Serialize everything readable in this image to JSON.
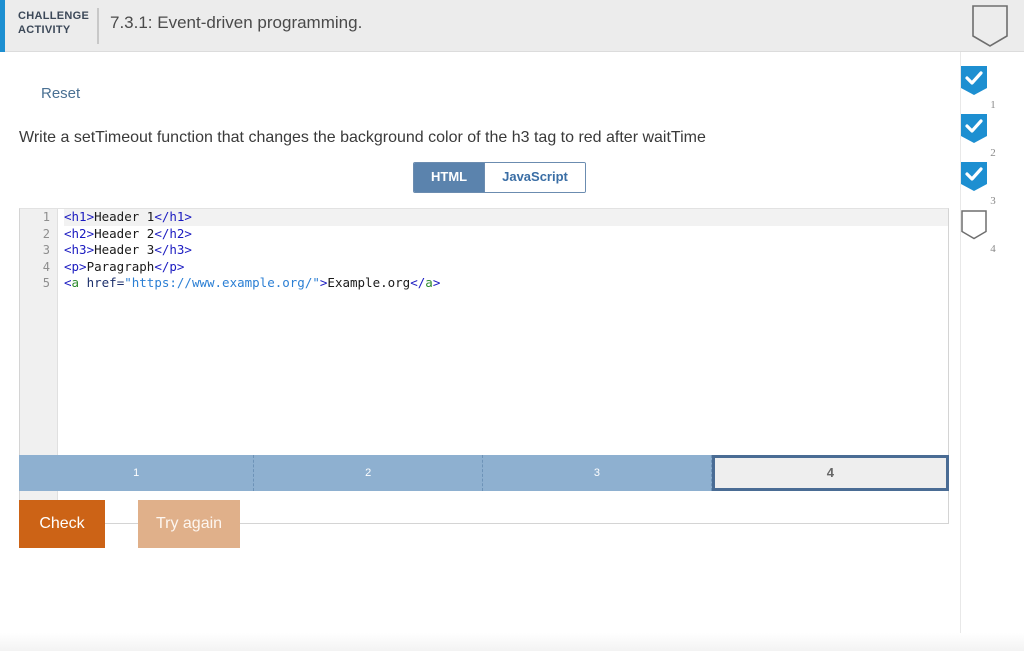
{
  "header": {
    "kicker_line1": "CHALLENGE",
    "kicker_line2": "ACTIVITY",
    "title": "7.3.1: Event-driven programming.",
    "accent_color": "#1d8fd1",
    "badge_icon": "bookmark-outline-icon"
  },
  "rail": {
    "items": [
      {
        "label": "1",
        "state": "checked",
        "icon": "bookmark-check-icon"
      },
      {
        "label": "2",
        "state": "checked",
        "icon": "bookmark-check-icon"
      },
      {
        "label": "3",
        "state": "checked",
        "icon": "bookmark-check-icon"
      },
      {
        "label": "4",
        "state": "empty",
        "icon": "bookmark-outline-icon"
      }
    ],
    "checked_color": "#1d8fd1",
    "empty_border_color": "#6e6e6e"
  },
  "main": {
    "reset_label": "Reset",
    "prompt": "Write a setTimeout function that changes the background color of the h3 tag to red after waitTime"
  },
  "tabs": {
    "items": [
      {
        "label": "HTML",
        "active": true
      },
      {
        "label": "JavaScript",
        "active": false
      }
    ],
    "active_bg": "#5b83ad",
    "inactive_fg": "#3a6ea5"
  },
  "editor": {
    "language": "HTML",
    "line_numbers": [
      "1",
      "2",
      "3",
      "4",
      "5"
    ],
    "lines": [
      {
        "number": "1",
        "active": true,
        "plain": "<h1>Header 1</h1>",
        "tokens": [
          {
            "t": "<h1>",
            "c": "tag"
          },
          {
            "t": "Header 1",
            "c": "text"
          },
          {
            "t": "</h1>",
            "c": "tag"
          }
        ]
      },
      {
        "number": "2",
        "active": false,
        "plain": "<h2>Header 2</h2>",
        "tokens": [
          {
            "t": "<h2>",
            "c": "tag"
          },
          {
            "t": "Header 2",
            "c": "text"
          },
          {
            "t": "</h2>",
            "c": "tag"
          }
        ]
      },
      {
        "number": "3",
        "active": false,
        "plain": "<h3>Header 3</h3>",
        "tokens": [
          {
            "t": "<h3>",
            "c": "tag"
          },
          {
            "t": "Header 3",
            "c": "text"
          },
          {
            "t": "</h3>",
            "c": "tag"
          }
        ]
      },
      {
        "number": "4",
        "active": false,
        "plain": "<p>Paragraph</p>",
        "tokens": [
          {
            "t": "<p>",
            "c": "tag"
          },
          {
            "t": "Paragraph",
            "c": "text"
          },
          {
            "t": "</p>",
            "c": "tag"
          }
        ]
      },
      {
        "number": "5",
        "active": false,
        "plain": "<a href=\"https://www.example.org/\">Example.org</a>",
        "tokens": [
          {
            "t": "<",
            "c": "tag"
          },
          {
            "t": "a",
            "c": "tagname-alt"
          },
          {
            "t": " href=",
            "c": "attr"
          },
          {
            "t": "\"https://www.example.org/\"",
            "c": "str"
          },
          {
            "t": ">",
            "c": "tag"
          },
          {
            "t": "Example.org",
            "c": "text"
          },
          {
            "t": "</",
            "c": "tag"
          },
          {
            "t": "a",
            "c": "tagname-alt"
          },
          {
            "t": ">",
            "c": "tag"
          }
        ]
      }
    ]
  },
  "steps": {
    "items": [
      {
        "label": "1",
        "state": "done"
      },
      {
        "label": "2",
        "state": "done"
      },
      {
        "label": "3",
        "state": "done"
      },
      {
        "label": "4",
        "state": "current"
      }
    ],
    "done_color": "#8eb0d0",
    "current_border_color": "#4a6c94"
  },
  "buttons": {
    "check_label": "Check",
    "check_color": "#cc6316",
    "try_again_label": "Try again",
    "try_again_color": "#e0b08a"
  }
}
